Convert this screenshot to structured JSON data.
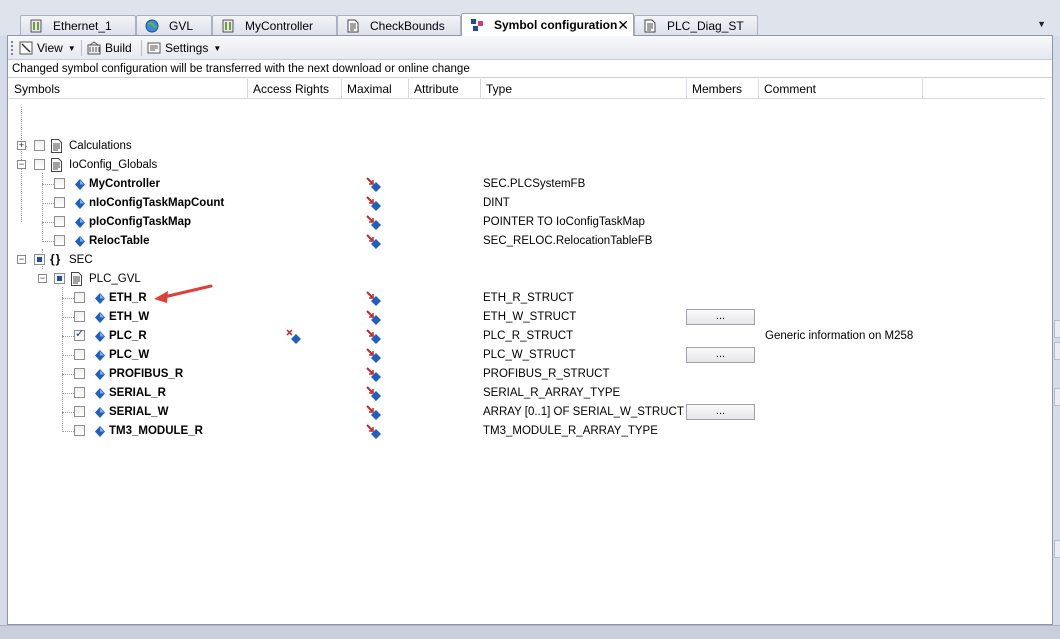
{
  "tabs": [
    {
      "label": "Ethernet_1",
      "icon": "device-icon"
    },
    {
      "label": "GVL",
      "icon": "globe-icon"
    },
    {
      "label": "MyController",
      "icon": "device-icon"
    },
    {
      "label": "CheckBounds",
      "icon": "document-icon"
    },
    {
      "label": "Symbol configuration",
      "icon": "symbol-config-icon",
      "active": true,
      "close": "✕"
    },
    {
      "label": "PLC_Diag_ST",
      "icon": "document-icon"
    }
  ],
  "toolbar": {
    "view_label": "View",
    "build_label": "Build",
    "settings_label": "Settings"
  },
  "info_message": "Changed symbol configuration will be transferred with the next download or online change",
  "columns": {
    "symbols": "Symbols",
    "access_rights": "Access Rights",
    "maximal": "Maximal",
    "attribute": "Attribute",
    "type": "Type",
    "members": "Members",
    "comment": "Comment"
  },
  "members_button_label": "...",
  "rows": [
    {
      "name": "Calculations",
      "type": "",
      "comment": ""
    },
    {
      "name": "IoConfig_Globals",
      "type": "",
      "comment": ""
    },
    {
      "name": "MyController",
      "type": "SEC.PLCSystemFB",
      "comment": ""
    },
    {
      "name": "nIoConfigTaskMapCount",
      "type": "DINT",
      "comment": ""
    },
    {
      "name": "pIoConfigTaskMap",
      "type": "POINTER TO IoConfigTaskMap",
      "comment": ""
    },
    {
      "name": "RelocTable",
      "type": "SEC_RELOC.RelocationTableFB",
      "comment": ""
    },
    {
      "name": "SEC",
      "type": "",
      "comment": ""
    },
    {
      "name": "PLC_GVL",
      "type": "",
      "comment": ""
    },
    {
      "name": "ETH_R",
      "type": "ETH_R_STRUCT",
      "comment": ""
    },
    {
      "name": "ETH_W",
      "type": "ETH_W_STRUCT",
      "comment": ""
    },
    {
      "name": "PLC_R",
      "type": "PLC_R_STRUCT",
      "comment": "Generic information on M258"
    },
    {
      "name": "PLC_W",
      "type": "PLC_W_STRUCT",
      "comment": ""
    },
    {
      "name": "PROFIBUS_R",
      "type": "PROFIBUS_R_STRUCT",
      "comment": ""
    },
    {
      "name": "SERIAL_R",
      "type": "SERIAL_R_ARRAY_TYPE",
      "comment": ""
    },
    {
      "name": "SERIAL_W",
      "type": "ARRAY [0..1] OF SERIAL_W_STRUCT",
      "comment": ""
    },
    {
      "name": "TM3_MODULE_R",
      "type": "TM3_MODULE_R_ARRAY_TYPE",
      "comment": ""
    }
  ],
  "colors": {
    "frame_bg": "#d6dbe9",
    "var_icon": "#1f5fbf",
    "annotation_arrow": "#e0403a"
  }
}
